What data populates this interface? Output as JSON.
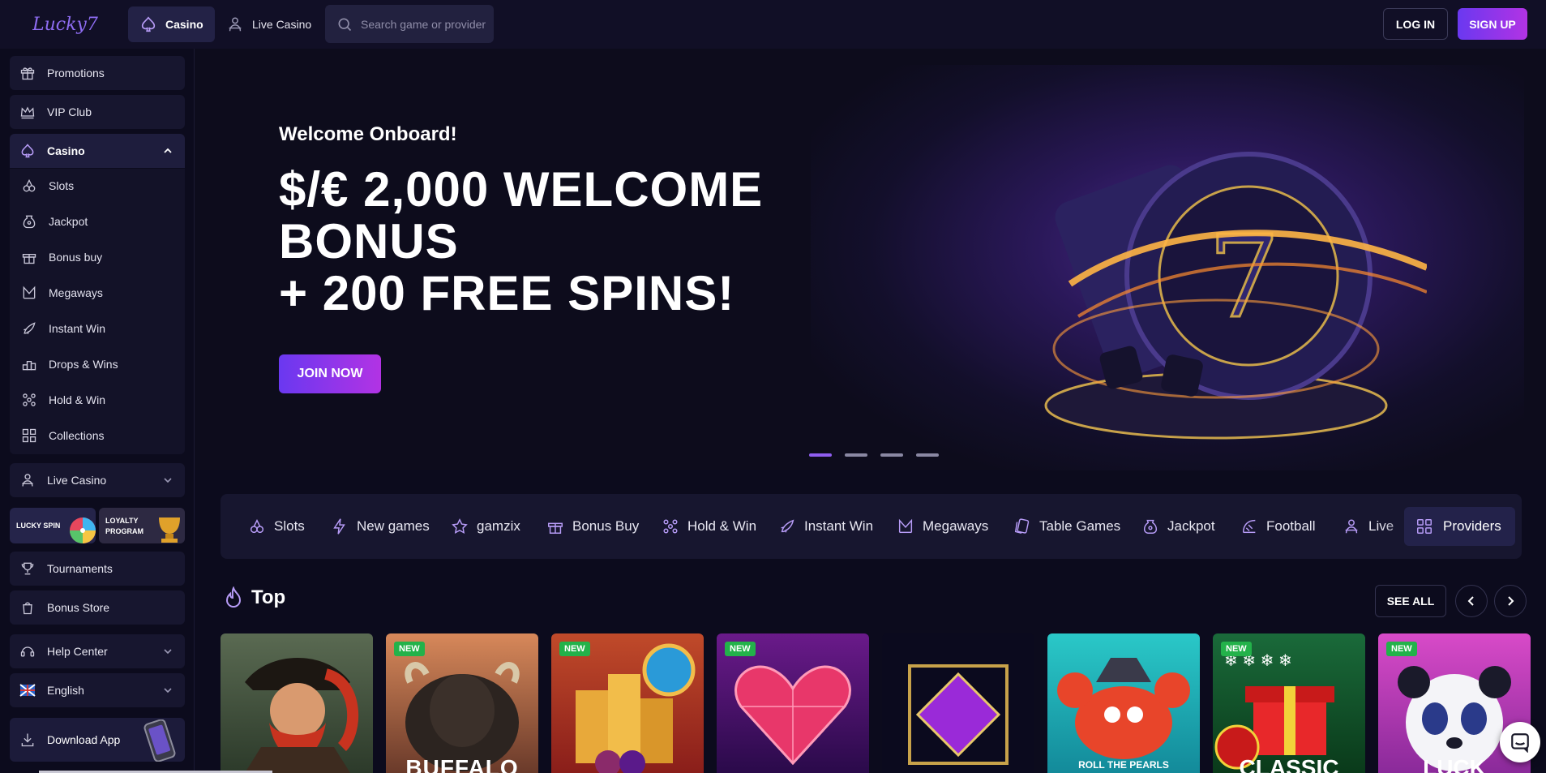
{
  "header": {
    "logo_text": "Lucky7",
    "tabs": [
      {
        "label": "Casino",
        "icon": "spade-icon",
        "active": true
      },
      {
        "label": "Live Casino",
        "icon": "dealer-icon",
        "active": false
      }
    ],
    "search_placeholder": "Search game or provider",
    "login_label": "LOG IN",
    "signup_label": "SIGN UP"
  },
  "sidebar": {
    "promotions": "Promotions",
    "vip": "VIP Club",
    "casino": "Casino",
    "casino_sub": [
      "Slots",
      "Jackpot",
      "Bonus buy",
      "Megaways",
      "Instant Win",
      "Drops & Wins",
      "Hold & Win",
      "Collections"
    ],
    "live_casino": "Live Casino",
    "lucky_spin": "LUCKY SPIN",
    "loyalty_line1": "LOYALTY",
    "loyalty_line2": "PROGRAM",
    "tournaments": "Tournaments",
    "bonus_store": "Bonus Store",
    "help_center": "Help Center",
    "language": "English",
    "download_app": "Download App"
  },
  "hero": {
    "subtitle": "Welcome Onboard!",
    "title_line1": "$/€ 2,000 WELCOME",
    "title_line2": "BONUS",
    "title_line3": "+ 200 FREE SPINS!",
    "cta": "JOIN NOW",
    "slides_total": 4,
    "active_slide": 1
  },
  "categories": [
    {
      "label": "Slots",
      "icon": "slots-icon"
    },
    {
      "label": "New games",
      "icon": "bolt-icon"
    },
    {
      "label": "gamzix",
      "icon": "star-icon"
    },
    {
      "label": "Bonus Buy",
      "icon": "gift-icon"
    },
    {
      "label": "Hold & Win",
      "icon": "grid-dots-icon"
    },
    {
      "label": "Instant Win",
      "icon": "rocket-icon"
    },
    {
      "label": "Megaways",
      "icon": "megaways-icon"
    },
    {
      "label": "Table Games",
      "icon": "cards-icon"
    },
    {
      "label": "Jackpot",
      "icon": "jackpot-icon"
    },
    {
      "label": "Football",
      "icon": "football-icon"
    },
    {
      "label": "Live",
      "icon": "dealer-icon"
    }
  ],
  "providers_label": "Providers",
  "top_section": {
    "title": "Top",
    "see_all": "SEE ALL"
  },
  "games": [
    {
      "new": false,
      "label": ""
    },
    {
      "new": true,
      "label": "BUFFALO"
    },
    {
      "new": true,
      "label": ""
    },
    {
      "new": true,
      "label": ""
    },
    {
      "new": false,
      "label": ""
    },
    {
      "new": false,
      "label": "ROLL THE PEARLS"
    },
    {
      "new": true,
      "label": "CLASSIC"
    },
    {
      "new": true,
      "label": "LUCK"
    }
  ],
  "badge_text": "NEW",
  "colors": {
    "accent_purple": "#8f5ef0",
    "cta_gradient_start": "#6a38f0",
    "cta_gradient_end": "#b233e4",
    "badge_green": "#23b24a",
    "background": "#0c0b1d"
  }
}
